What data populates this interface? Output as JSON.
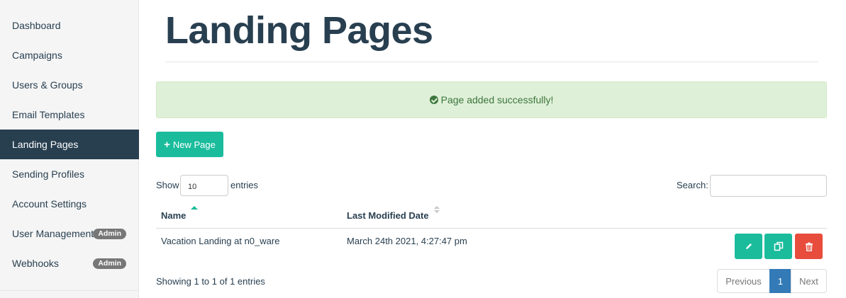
{
  "sidebar": {
    "items": [
      {
        "label": "Dashboard"
      },
      {
        "label": "Campaigns"
      },
      {
        "label": "Users & Groups"
      },
      {
        "label": "Email Templates"
      },
      {
        "label": "Landing Pages",
        "active": true
      },
      {
        "label": "Sending Profiles"
      },
      {
        "label": "Account Settings"
      },
      {
        "label": "User Management",
        "badge": "Admin"
      },
      {
        "label": "Webhooks",
        "badge": "Admin"
      }
    ]
  },
  "page": {
    "title": "Landing Pages",
    "alert": "Page added successfully!",
    "new_button": "New Page"
  },
  "table_controls": {
    "show_label": "Show",
    "page_size": "10",
    "entries_label": "entries",
    "search_label": "Search:"
  },
  "table": {
    "columns": [
      "Name",
      "Last Modified Date"
    ],
    "rows": [
      {
        "name": "Vacation Landing at n0_ware",
        "modified": "March 24th 2021, 4:27:47 pm"
      }
    ]
  },
  "footer": {
    "info": "Showing 1 to 1 of 1 entries",
    "previous": "Previous",
    "page": "1",
    "next": "Next"
  },
  "colors": {
    "sidebar_active": "#283f50",
    "accent": "#1abc9c",
    "danger": "#e74c3c",
    "alert_bg": "#dff0d8",
    "pager_active": "#337ab7"
  },
  "icons": {
    "alert": "check-circle-icon",
    "new": "plus-icon",
    "edit": "pencil-icon",
    "copy": "copy-icon",
    "delete": "trash-icon",
    "sort_name": "sort-asc-icon",
    "sort_date": "sort-both-icon"
  }
}
